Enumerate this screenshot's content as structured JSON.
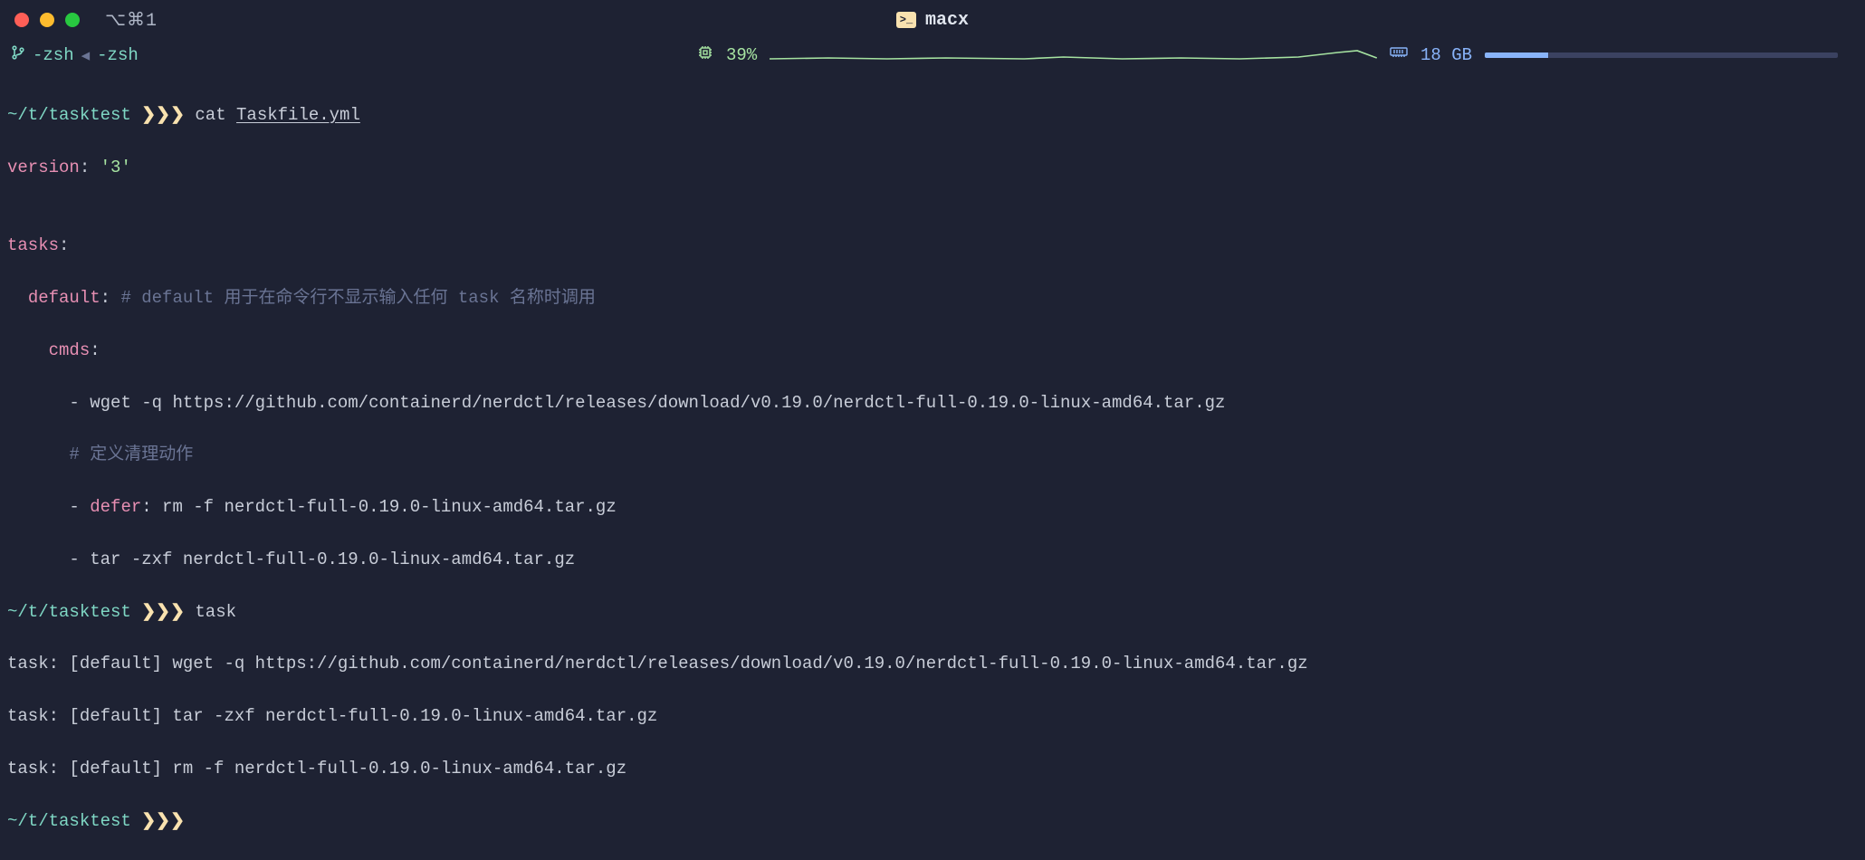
{
  "titlebar": {
    "shortcut": "⌥⌘1",
    "icon_glyph": ">_",
    "title": "macx"
  },
  "statusbar": {
    "tab_left": "-zsh",
    "tab_sep": "◂",
    "tab_right": "-zsh",
    "cpu_percent": "39%",
    "mem_value": "18 GB"
  },
  "term": {
    "prompt_path": "~/t/tasktest",
    "chevrons": "❯❯❯",
    "cmd1": {
      "cmd": "cat",
      "arg": "Taskfile.yml"
    },
    "yaml": {
      "l1_key": "version",
      "l1_sep": ":",
      "l1_val": " '3'",
      "l2_blank": "",
      "l3_key": "tasks",
      "l3_sep": ":",
      "l4_indent": "  ",
      "l4_key": "default",
      "l4_sep": ":",
      "l4_cmt": " # default 用于在命令行不显示输入任何 task 名称时调用",
      "l5_indent": "    ",
      "l5_key": "cmds",
      "l5_sep": ":",
      "l6_indent": "      ",
      "l6_dash": "- ",
      "l6_val": "wget -q https://github.com/containerd/nerdctl/releases/download/v0.19.0/nerdctl-full-0.19.0-linux-amd64.tar.gz",
      "l7_indent": "      ",
      "l7_cmt": "# 定义清理动作",
      "l8_indent": "      ",
      "l8_dash": "- ",
      "l8_key": "defer",
      "l8_sep": ":",
      "l8_val": " rm -f nerdctl-full-0.19.0-linux-amd64.tar.gz",
      "l9_indent": "      ",
      "l9_dash": "- ",
      "l9_val": "tar -zxf nerdctl-full-0.19.0-linux-amd64.tar.gz"
    },
    "cmd2": "task",
    "out1": "task: [default] wget -q https://github.com/containerd/nerdctl/releases/download/v0.19.0/nerdctl-full-0.19.0-linux-amd64.tar.gz",
    "out2": "task: [default] tar -zxf nerdctl-full-0.19.0-linux-amd64.tar.gz",
    "out3": "task: [default] rm -f nerdctl-full-0.19.0-linux-amd64.tar.gz"
  }
}
